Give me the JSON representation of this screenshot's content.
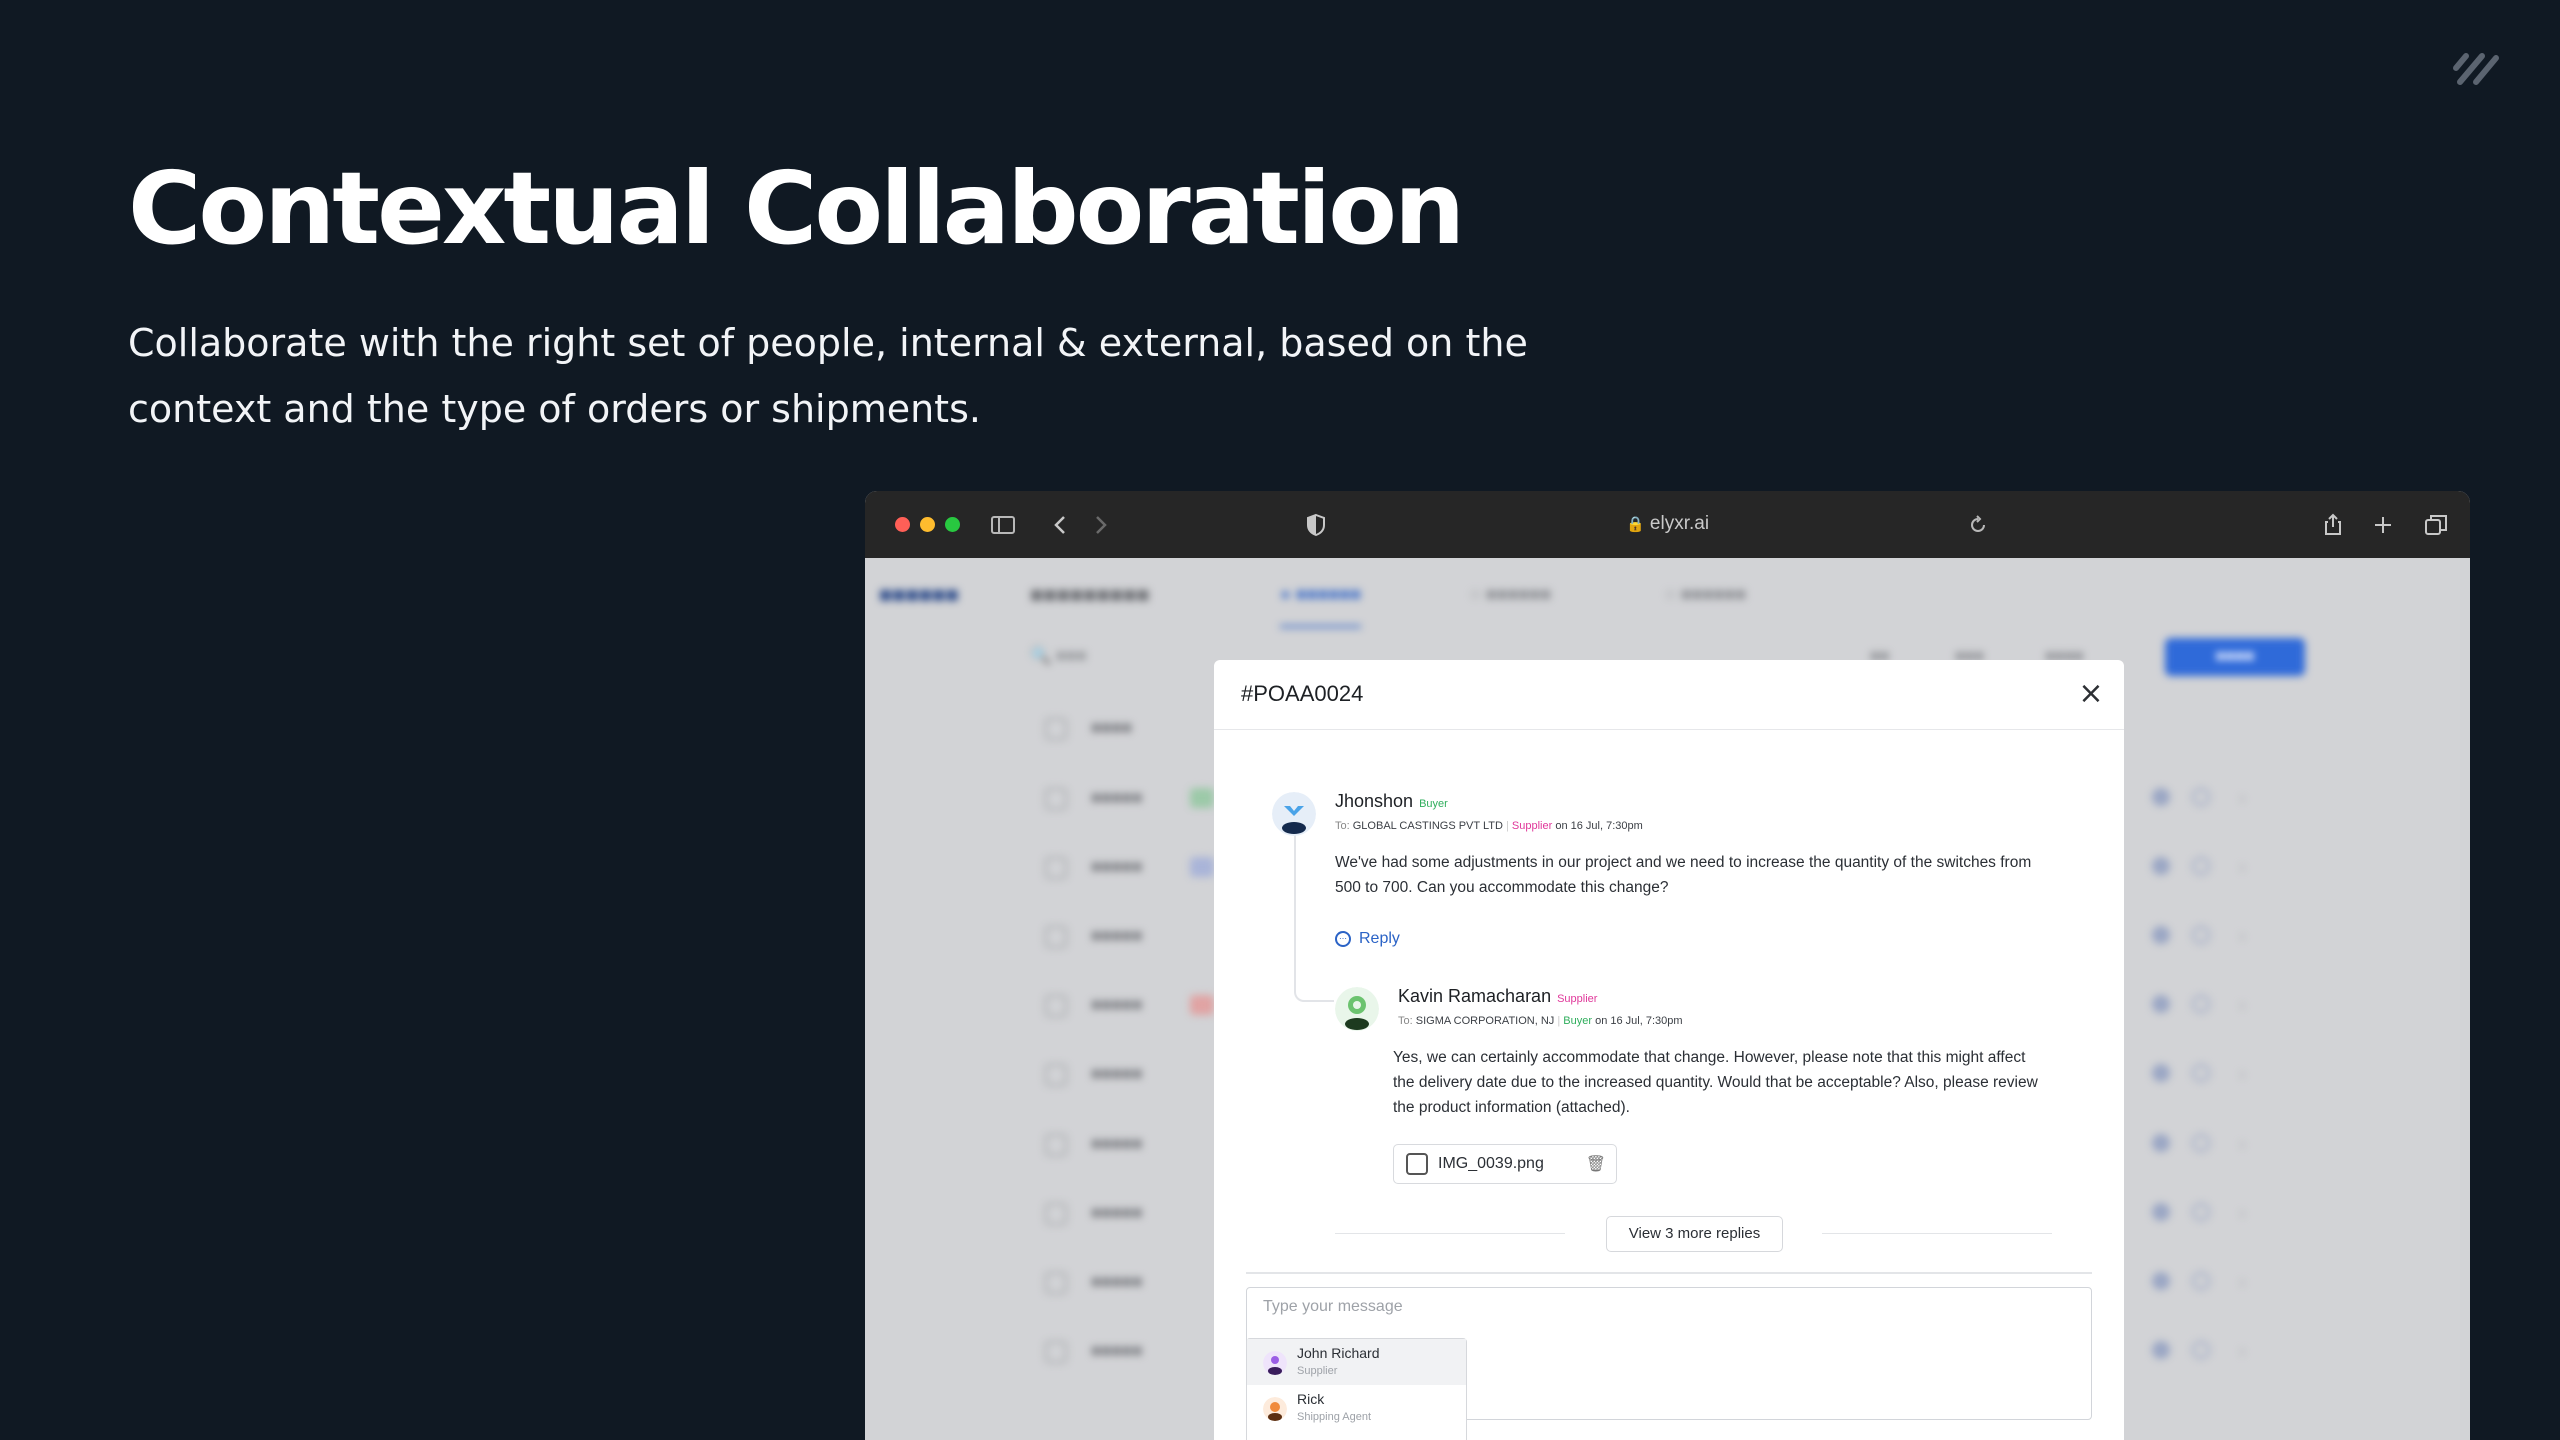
{
  "hero": {
    "title": "Contextual Collaboration",
    "subtitle": "Collaborate with the right set of people, internal & external, based on the context and the type of orders or shipments."
  },
  "browser": {
    "url": "elyxr.ai",
    "traffic_colors": [
      "#ff5f57",
      "#febc2e",
      "#28c840"
    ]
  },
  "modal": {
    "title": "#POAA0024",
    "messages": [
      {
        "author": "Jhonshon",
        "role": "Buyer",
        "to_prefix": "To:",
        "to": "GLOBAL CASTINGS PVT LTD",
        "to_role": "Supplier",
        "when": "on 16 Jul, 7:30pm",
        "body": "We've had some adjustments in our project and we need to increase the quantity of the switches from 500 to 700. Can you accommodate this change?",
        "reply_label": "Reply"
      },
      {
        "author": "Kavin Ramacharan",
        "role": "Supplier",
        "to_prefix": "To:",
        "to": "SIGMA CORPORATION, NJ",
        "to_role": "Buyer",
        "when": "on 16 Jul, 7:30pm",
        "body": "Yes, we can certainly accommodate that change. However, please note that this might affect the delivery date due to the increased quantity. Would that be acceptable? Also, please review the product information (attached).",
        "attachment": "IMG_0039.png"
      }
    ],
    "more_replies": "View 3 more replies",
    "composer_placeholder": "Type your message",
    "mentions": [
      {
        "name": "John Richard",
        "role": "Supplier"
      },
      {
        "name": "Rick",
        "role": "Shipping Agent"
      }
    ]
  },
  "colors": {
    "buyer": "#2fae5c",
    "supplier": "#e0379a",
    "link": "#2b63c6"
  }
}
